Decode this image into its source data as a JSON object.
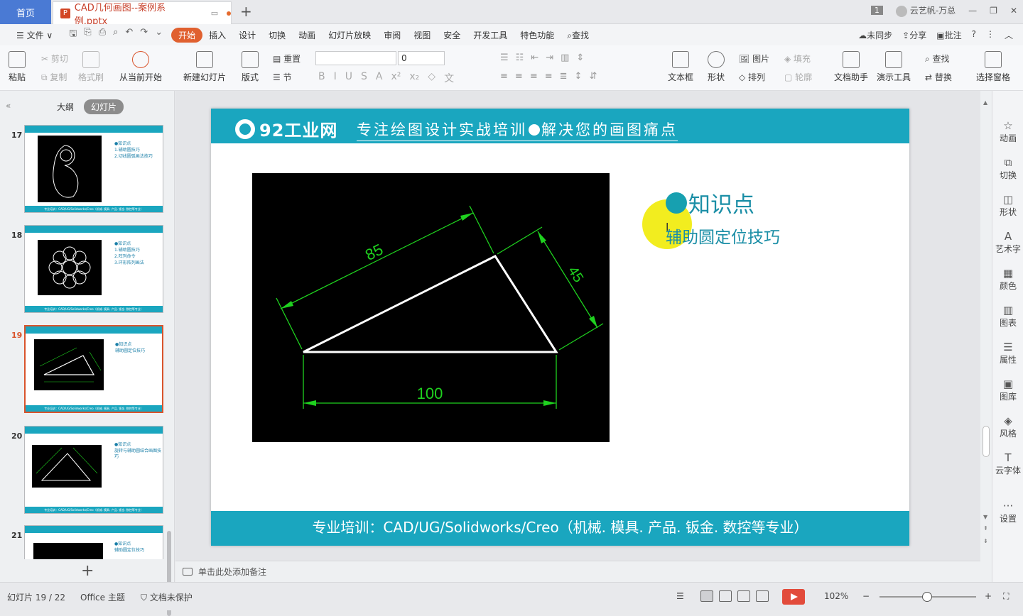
{
  "titlebar": {
    "home_tab": "首页",
    "doc_tab": "CAD几何画图--案例系例.pptx",
    "badge": "1",
    "user": "云艺帆-万总",
    "minimize": "—",
    "restore": "❐",
    "close": "✕"
  },
  "menu": {
    "file": "文件",
    "tabs": [
      "开始",
      "插入",
      "设计",
      "切换",
      "动画",
      "幻灯片放映",
      "审阅",
      "视图",
      "安全",
      "开发工具",
      "特色功能"
    ],
    "search": "查找",
    "sync": "未同步",
    "share": "分享",
    "comment": "批注",
    "help": "?"
  },
  "ribbon": {
    "paste": "粘贴",
    "cut": "剪切",
    "copy": "复制",
    "format_painter": "格式刷",
    "from_current": "从当前开始",
    "new_slide": "新建幻灯片",
    "layout": "版式",
    "reset": "重置",
    "section": "节",
    "font_size": "0",
    "textbox": "文本框",
    "shape": "形状",
    "picture": "图片",
    "fill": "填充",
    "arrange": "排列",
    "outline": "轮廓",
    "doc_helper": "文档助手",
    "presentation_tools": "演示工具",
    "find": "查找",
    "replace": "替换",
    "selection_pane": "选择窗格"
  },
  "leftpanel": {
    "tab_outline": "大纲",
    "tab_slides": "幻灯片",
    "thumb_footer": "专业培训：CAD/UG/Solidworks/Creo（机械. 模具. 产品. 钣金. 数控等专业）",
    "thumbs": [
      {
        "num": "17",
        "kp": "●知识点",
        "lines": [
          "1.辅助圆技巧",
          "2.切线圆弧画法技巧"
        ]
      },
      {
        "num": "18",
        "kp": "●知识点",
        "lines": [
          "1.辅助圆技巧",
          "2.阵列命令",
          "3.环形阵列画法"
        ]
      },
      {
        "num": "19",
        "kp": "●知识点",
        "lines": [
          "辅助圆定位技巧"
        ]
      },
      {
        "num": "20",
        "kp": "●知识点",
        "lines": [
          "旋转与辅助圆结合画图技巧"
        ]
      },
      {
        "num": "21",
        "kp": "●知识点",
        "lines": [
          "辅助圆定位技巧"
        ]
      }
    ],
    "add": "+"
  },
  "slide": {
    "logo_text": "92工业网",
    "tagline_left": "专注绘图设计实战培训",
    "tagline_right": "解决您的画图痛点",
    "knowledge_title": "知识点",
    "knowledge_item": "辅助圆定位技巧",
    "dim_top": "85",
    "dim_right": "45",
    "dim_bottom": "100",
    "footer": "专业培训：CAD/UG/Solidworks/Creo（机械. 模具. 产品. 钣金. 数控等专业）"
  },
  "notes": {
    "placeholder": "单击此处添加备注"
  },
  "rightbar": [
    "动画",
    "切换",
    "形状",
    "艺术字",
    "颜色",
    "图表",
    "属性",
    "图库",
    "风格",
    "云字体",
    "设置"
  ],
  "status": {
    "slide_counter": "幻灯片 19 / 22",
    "theme": "Office 主题",
    "protect": "文档未保护",
    "zoom": "102%"
  },
  "colors": {
    "accent": "#1aa6bf",
    "wps_orange": "#e0602f",
    "cad_green": "#1fd11f"
  }
}
